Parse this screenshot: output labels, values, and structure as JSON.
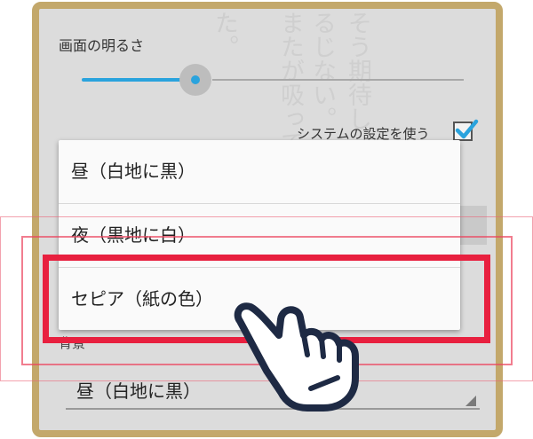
{
  "background_text": [
    "そう期待し",
    "るじない。",
    "またが吸って",
    "た。"
  ],
  "brightness": {
    "label": "画面の明るさ",
    "slider_value_percent": 28
  },
  "system_setting": {
    "label": "システムの設定を使う",
    "checked": true
  },
  "dropdown_menu": {
    "items": [
      "昼（白地に黒）",
      "夜（黒地に白）",
      "セピア（紙の色）"
    ],
    "highlighted_index": 2
  },
  "background_setting": {
    "label": "背景",
    "selected_value": "昼（白地に黒）"
  },
  "colors": {
    "frame": "#c3a86b",
    "slider_accent": "#2aa3dd",
    "highlight": "#e8203f",
    "hand_outline": "#1e2a44"
  },
  "icons": [
    "checkmark-icon",
    "dropdown-arrow-icon",
    "pointing-hand-icon"
  ]
}
